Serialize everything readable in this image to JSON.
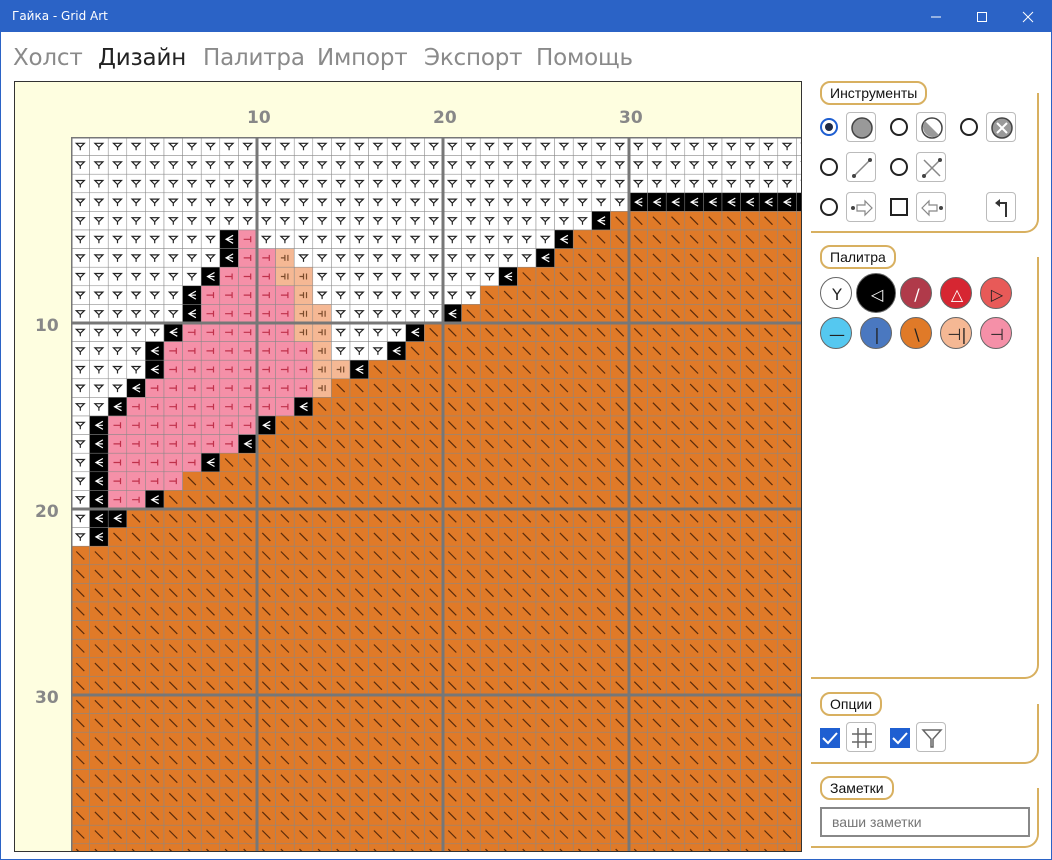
{
  "window": {
    "title": "Гайка - Grid Art"
  },
  "menu": {
    "items": [
      "Холст",
      "Дизайн",
      "Палитра",
      "Импорт",
      "Экспорт",
      "Помощь"
    ],
    "active_index": 1
  },
  "canvas": {
    "col_labels": [
      "10",
      "20",
      "30"
    ],
    "row_labels": [
      "10",
      "20",
      "30"
    ]
  },
  "tools": {
    "header": "Инструменты",
    "selected": "fill-circle"
  },
  "palette": {
    "header": "Палитра",
    "swatches": [
      {
        "name": "white-y",
        "color": "#ffffff",
        "glyph": "Y",
        "glyph_color": "#222"
      },
      {
        "name": "black-arrow",
        "color": "#000000",
        "glyph": "◁",
        "glyph_color": "#fff",
        "selected": true
      },
      {
        "name": "maroon-slash",
        "color": "#b03a4a",
        "glyph": "/",
        "glyph_color": "#fff"
      },
      {
        "name": "red-tri",
        "color": "#d62632",
        "glyph": "△",
        "glyph_color": "#fff"
      },
      {
        "name": "coral-tri",
        "color": "#e85a58",
        "glyph": "▷",
        "glyph_color": "#222"
      },
      {
        "name": "cyan-dash",
        "color": "#55c8f0",
        "glyph": "—",
        "glyph_color": "#222"
      },
      {
        "name": "blue-bar",
        "color": "#4a78c0",
        "glyph": "|",
        "glyph_color": "#222"
      },
      {
        "name": "orange-backslash",
        "color": "#e07a28",
        "glyph": "\\",
        "glyph_color": "#222"
      },
      {
        "name": "peach-bars",
        "color": "#f5b894",
        "glyph": "⊣|",
        "glyph_color": "#222"
      },
      {
        "name": "pink-tee",
        "color": "#f590a8",
        "glyph": "⊣",
        "glyph_color": "#222"
      }
    ]
  },
  "options": {
    "header": "Опции",
    "grid_checked": true,
    "symbols_checked": true
  },
  "notes": {
    "header": "Заметки",
    "placeholder": "ваши заметки"
  },
  "colors": {
    "titlebar": "#2b63c6",
    "panel_border": "#d8b060",
    "canvas_bg": "#fefee0"
  }
}
